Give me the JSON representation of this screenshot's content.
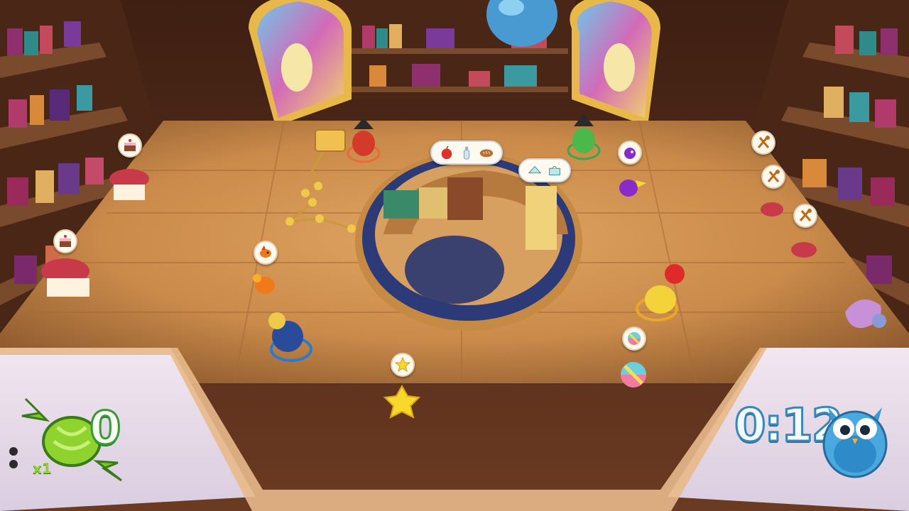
{
  "hud": {
    "candy_score": "0",
    "multiplier": "x1",
    "timer": "0:12",
    "menu_dots_icon": "dots-icon",
    "candy_icon": "green-candy-icon",
    "owl_icon": "owl-timer-icon"
  },
  "orders": {
    "center_order_items": [
      "apple-icon",
      "baby-bottle-icon",
      "bread-icon"
    ],
    "right_order_items": [
      "sandwich-icon",
      "tissue-box-icon"
    ]
  },
  "request_bubbles": [
    {
      "icon": "cake-icon"
    },
    {
      "icon": "cake-icon"
    },
    {
      "icon": "fire-bird-icon"
    },
    {
      "icon": "star-creature-icon"
    },
    {
      "icon": "beach-ball-icon"
    },
    {
      "icon": "purple-creature-icon"
    },
    {
      "icon": "spoon-fork-icon"
    },
    {
      "icon": "spoon-fork-icon"
    },
    {
      "icon": "spoon-fork-icon"
    }
  ],
  "colors": {
    "floor": "#c98a4a",
    "wall": "#5a2f1c",
    "score_fill": "#f8fff0",
    "score_stroke": "#3a9a3a",
    "timer_stroke": "#3a86b4",
    "counter_blue": "#2c3a78"
  }
}
